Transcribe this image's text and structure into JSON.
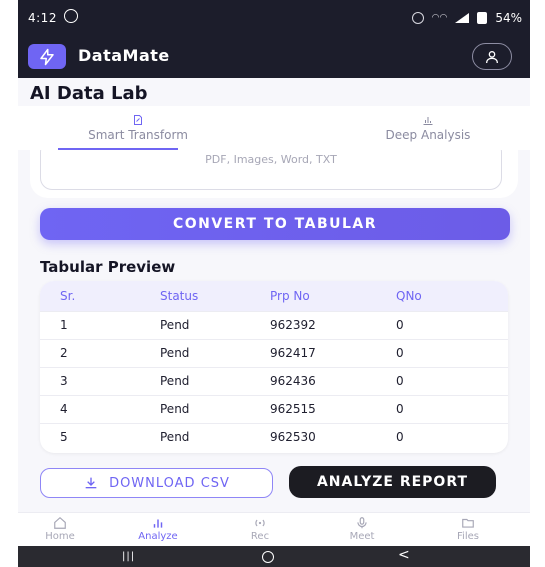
{
  "status": {
    "time": "4:12",
    "battery": "54%"
  },
  "app": {
    "title": "DataMate"
  },
  "page": {
    "title": "AI Data Lab"
  },
  "tabs": [
    {
      "label": "Smart Transform",
      "active": true,
      "icon": "edit-document-icon"
    },
    {
      "label": "Deep Analysis",
      "active": false,
      "icon": "bar-chart-icon"
    }
  ],
  "upload": {
    "hint": "PDF, Images, Word, TXT"
  },
  "actions": {
    "convert": "CONVERT TO TABULAR",
    "download": "DOWNLOAD CSV",
    "analyze": "ANALYZE REPORT"
  },
  "preview": {
    "title": "Tabular Preview",
    "columns": [
      "Sr.",
      "Status",
      "Prp No",
      "QNo"
    ],
    "rows": [
      [
        "1",
        "Pend",
        "962392",
        "0"
      ],
      [
        "2",
        "Pend",
        "962417",
        "0"
      ],
      [
        "3",
        "Pend",
        "962436",
        "0"
      ],
      [
        "4",
        "Pend",
        "962515",
        "0"
      ],
      [
        "5",
        "Pend",
        "962530",
        "0"
      ]
    ]
  },
  "nav": [
    {
      "label": "Home",
      "icon": "home-icon",
      "active": false
    },
    {
      "label": "Analyze",
      "icon": "analyze-icon",
      "active": true
    },
    {
      "label": "Rec",
      "icon": "broadcast-icon",
      "active": false
    },
    {
      "label": "Meet",
      "icon": "microphone-icon",
      "active": false
    },
    {
      "label": "Files",
      "icon": "folder-icon",
      "active": false
    }
  ],
  "colors": {
    "accent": "#6f65f3",
    "dark": "#1c1d2b"
  }
}
